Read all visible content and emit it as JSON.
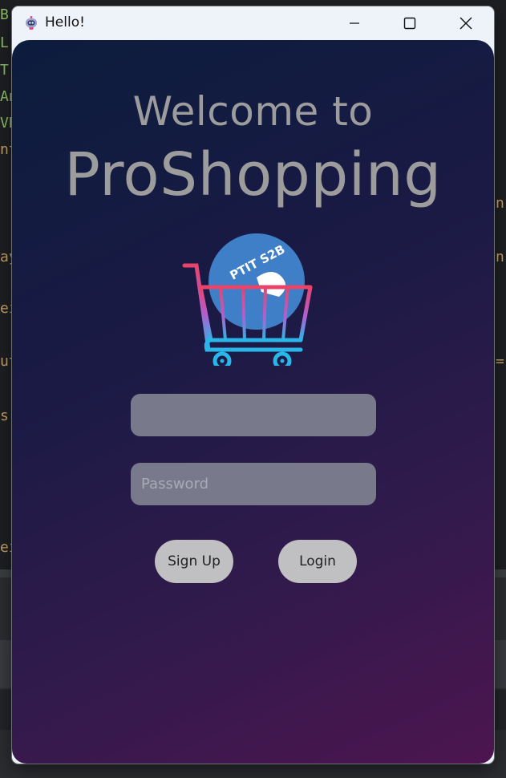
{
  "window": {
    "title": "Hello!",
    "icon": "app-robot-icon",
    "controls": [
      "minimize-icon",
      "maximize-icon",
      "close-icon"
    ]
  },
  "ide_background": {
    "left_fragments": [
      "B",
      "L",
      "T",
      "An",
      "VB",
      "nt",
      "ay",
      "ei",
      "ut",
      "s",
      "ei"
    ],
    "right_fragments": [
      "n",
      "n",
      "="
    ]
  },
  "login": {
    "welcome_text": "Welcome to",
    "brand_text": "ProShopping",
    "logo_text": "PTIT S2B",
    "username": {
      "value": "",
      "placeholder": ""
    },
    "password": {
      "value": "",
      "placeholder": "Password"
    },
    "signup_label": "Sign Up",
    "login_label": "Login"
  },
  "colors": {
    "gradient_start": "#0c1c3d",
    "gradient_end": "#4d1550",
    "heading_text": "#9c9c9c",
    "field_bg": "#787a8b",
    "button_bg": "#c0bfc1",
    "logo_circle": "#3f7fc8",
    "cart_top": "#e8446a",
    "cart_bottom": "#29b6e8"
  }
}
